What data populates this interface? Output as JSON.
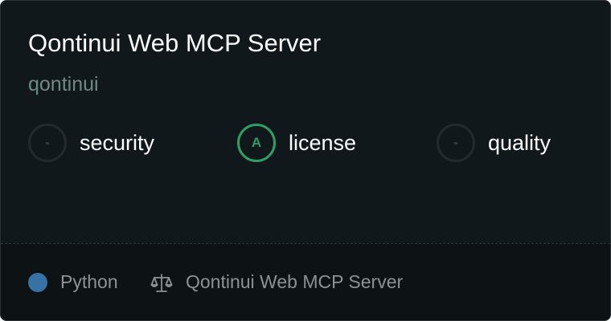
{
  "server": {
    "title": "Qontinui Web MCP Server",
    "owner": "qontinui"
  },
  "scores": [
    {
      "label": "security",
      "grade": "-"
    },
    {
      "label": "license",
      "grade": "A"
    },
    {
      "label": "quality",
      "grade": "-"
    }
  ],
  "footer": {
    "language": "Python",
    "language_color": "#3672a4",
    "license_icon": "scale-icon",
    "license_name": "Qontinui Web MCP Server"
  },
  "colors": {
    "background": "#11181b",
    "footer_background": "#0d1315",
    "grade_a": "#2f9e63",
    "owner": "#6f8a83"
  }
}
